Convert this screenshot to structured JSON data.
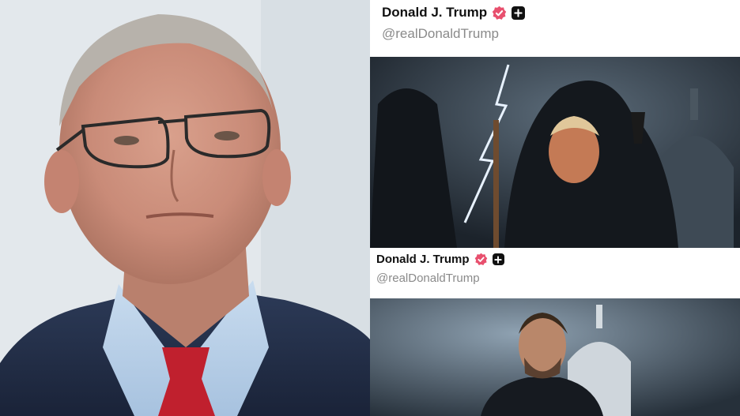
{
  "posts": [
    {
      "author": "Donald J. Trump",
      "handle": "@realDonaldTrump",
      "badges": [
        "verified-badge-icon",
        "plus-badge-icon"
      ],
      "accent_color": "#e8506e"
    },
    {
      "author": "Donald J. Trump",
      "handle": "@realDonaldTrump",
      "badges": [
        "verified-badge-icon",
        "plus-badge-icon"
      ],
      "accent_color": "#e8506e"
    }
  ]
}
